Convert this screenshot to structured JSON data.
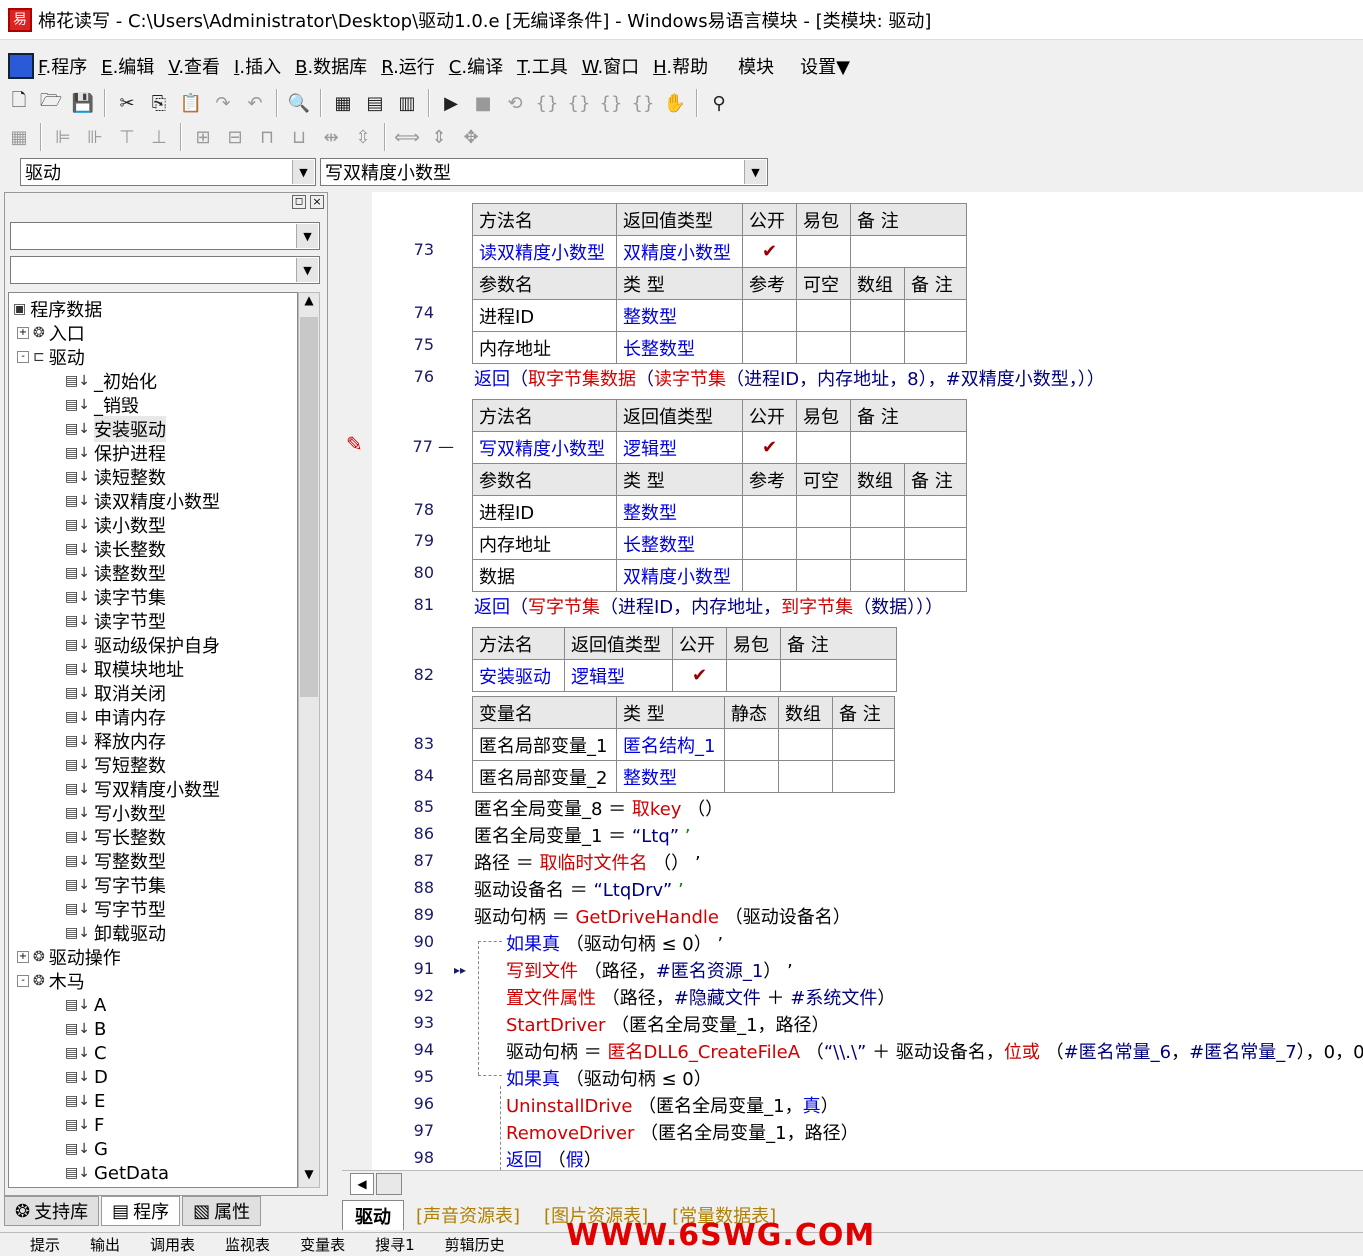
{
  "window": {
    "title": "棉花读写 - C:\\Users\\Administrator\\Desktop\\驱动1.0.e [无编译条件] - Windows易语言模块 - [类模块: 驱动]"
  },
  "menu": {
    "items": [
      {
        "key": "F",
        "label": ".程序"
      },
      {
        "key": "E",
        "label": ".编辑"
      },
      {
        "key": "V",
        "label": ".查看"
      },
      {
        "key": "I",
        "label": ".插入"
      },
      {
        "key": "B",
        "label": ".数据库"
      },
      {
        "key": "R",
        "label": ".运行"
      },
      {
        "key": "C",
        "label": ".编译"
      },
      {
        "key": "T",
        "label": ".工具"
      },
      {
        "key": "W",
        "label": ".窗口"
      },
      {
        "key": "H",
        "label": ".帮助"
      },
      {
        "key": "",
        "label": "模块"
      },
      {
        "key": "",
        "label": "设置▼"
      }
    ]
  },
  "combos": {
    "module": "驱动",
    "method": "写双精度小数型"
  },
  "tree": {
    "root": "程序数据",
    "items": [
      {
        "label": "入口",
        "level": 1,
        "type": "folder",
        "pm": "+"
      },
      {
        "label": "驱动",
        "level": 1,
        "type": "class",
        "pm": "-"
      },
      {
        "label": "_初始化",
        "level": 2,
        "type": "sub"
      },
      {
        "label": "_销毁",
        "level": 2,
        "type": "sub"
      },
      {
        "label": "安装驱动",
        "level": 2,
        "type": "sub"
      },
      {
        "label": "保护进程",
        "level": 2,
        "type": "sub"
      },
      {
        "label": "读短整数",
        "level": 2,
        "type": "sub"
      },
      {
        "label": "读双精度小数型",
        "level": 2,
        "type": "sub"
      },
      {
        "label": "读小数型",
        "level": 2,
        "type": "sub"
      },
      {
        "label": "读长整数",
        "level": 2,
        "type": "sub"
      },
      {
        "label": "读整数型",
        "level": 2,
        "type": "sub"
      },
      {
        "label": "读字节集",
        "level": 2,
        "type": "sub"
      },
      {
        "label": "读字节型",
        "level": 2,
        "type": "sub"
      },
      {
        "label": "驱动级保护自身",
        "level": 2,
        "type": "sub"
      },
      {
        "label": "取模块地址",
        "level": 2,
        "type": "sub"
      },
      {
        "label": "取消关闭",
        "level": 2,
        "type": "sub"
      },
      {
        "label": "申请内存",
        "level": 2,
        "type": "sub"
      },
      {
        "label": "释放内存",
        "level": 2,
        "type": "sub"
      },
      {
        "label": "写短整数",
        "level": 2,
        "type": "sub"
      },
      {
        "label": "写双精度小数型",
        "level": 2,
        "type": "sub"
      },
      {
        "label": "写小数型",
        "level": 2,
        "type": "sub"
      },
      {
        "label": "写长整数",
        "level": 2,
        "type": "sub"
      },
      {
        "label": "写整数型",
        "level": 2,
        "type": "sub"
      },
      {
        "label": "写字节集",
        "level": 2,
        "type": "sub"
      },
      {
        "label": "写字节型",
        "level": 2,
        "type": "sub"
      },
      {
        "label": "卸载驱动",
        "level": 2,
        "type": "sub"
      },
      {
        "label": "驱动操作",
        "level": 1,
        "type": "folder",
        "pm": "+"
      },
      {
        "label": "木马",
        "level": 1,
        "type": "folder",
        "pm": "-"
      },
      {
        "label": "A",
        "level": 2,
        "type": "sub"
      },
      {
        "label": "B",
        "level": 2,
        "type": "sub"
      },
      {
        "label": "C",
        "level": 2,
        "type": "sub"
      },
      {
        "label": "D",
        "level": 2,
        "type": "sub"
      },
      {
        "label": "E",
        "level": 2,
        "type": "sub"
      },
      {
        "label": "F",
        "level": 2,
        "type": "sub"
      },
      {
        "label": "G",
        "level": 2,
        "type": "sub"
      },
      {
        "label": "GetData",
        "level": 2,
        "type": "sub"
      }
    ]
  },
  "bottomtabs": [
    "支持库",
    "程序",
    "属性"
  ],
  "sheettabs": [
    "驱动",
    "[声音资源表]",
    "[图片资源表]",
    "[常量数据表]"
  ],
  "status": [
    "提示",
    "输出",
    "调用表",
    "监视表",
    "变量表",
    "搜寻1",
    "剪辑历史"
  ],
  "watermark": "WWW.6SWG.COM",
  "editor": {
    "hdr_method": [
      "方法名",
      "返回值类型",
      "公开",
      "易包",
      "备 注"
    ],
    "hdr_param": [
      "参数名",
      "类 型",
      "参考",
      "可空",
      "数组",
      "备 注"
    ],
    "hdr_var": [
      "变量名",
      "类 型",
      "静态",
      "数组",
      "备 注"
    ],
    "m1": {
      "name": "读双精度小数型",
      "ret": "双精度小数型",
      "check": "✔"
    },
    "m1p": [
      {
        "n": "进程ID",
        "t": "整数型"
      },
      {
        "n": "内存地址",
        "t": "长整数型"
      }
    ],
    "m2": {
      "name": "写双精度小数型",
      "ret": "逻辑型",
      "check": "✔"
    },
    "m2p": [
      {
        "n": "进程ID",
        "t": "整数型"
      },
      {
        "n": "内存地址",
        "t": "长整数型"
      },
      {
        "n": "数据",
        "t": "双精度小数型"
      }
    ],
    "m3": {
      "name": "安装驱动",
      "ret": "逻辑型",
      "check": "✔"
    },
    "m3v": [
      {
        "n": "匿名局部变量_1",
        "t": "匿名结构_1"
      },
      {
        "n": "匿名局部变量_2",
        "t": "整数型"
      }
    ],
    "lines": {
      "l73": "73",
      "l74": "74",
      "l75": "75",
      "l76": "76",
      "l77": "77 —",
      "l78": "78",
      "l79": "79",
      "l80": "80",
      "l81": "81",
      "l82": "82",
      "l83": "83",
      "l84": "84",
      "l85": "85",
      "l86": "86",
      "l87": "87",
      "l88": "88",
      "l89": "89",
      "l90": "90",
      "l91": "91",
      "l92": "92",
      "l93": "93",
      "l94": "94",
      "l95": "95",
      "l96": "96",
      "l97": "97",
      "l98": "98"
    },
    "c76": {
      "a": "返回",
      "b": "（",
      "c": "取字节集数据",
      "d": "（",
      "e": "读字节集",
      "f": "（进程ID，内存地址，8），",
      "g": "#双精度小数型",
      "h": "，））"
    },
    "c81": {
      "a": "返回",
      "b": "（",
      "c": "写字节集",
      "d": "（进程ID，内存地址，",
      "e": "到字节集",
      "f": "（数据）））"
    },
    "c85": {
      "a": "匿名全局变量_8 ＝ ",
      "b": "取key",
      "c": " （）"
    },
    "c86": {
      "a": "匿名全局变量_1 ＝ ",
      "b": "“Ltq”",
      "c": " ’"
    },
    "c87": {
      "a": "路径 ＝ ",
      "b": "取临时文件名",
      "c": " （） ’"
    },
    "c88": {
      "a": "驱动设备名 ＝ ",
      "b": "“LtqDrv”",
      "c": " ’"
    },
    "c89": {
      "a": "驱动句柄 ＝ ",
      "b": "GetDriveHandle",
      "c": " （驱动设备名）"
    },
    "c90": {
      "a": "如果真",
      "b": " （驱动句柄 ≤ 0） ’"
    },
    "c91": {
      "a": "写到文件",
      "b": " （路径，",
      "c": "#匿名资源_1",
      "d": "） ’"
    },
    "c92": {
      "a": "置文件属性",
      "b": " （路径，",
      "c": "#隐藏文件",
      "d": " ＋ ",
      "e": "#系统文件",
      "f": "）"
    },
    "c93": {
      "a": "StartDriver",
      "b": " （匿名全局变量_1，路径）"
    },
    "c94": {
      "a": "驱动句柄 ＝ ",
      "b": "匿名DLL6_CreateFileA",
      "c": " （",
      "d": "“\\\\.\\”",
      "e": " ＋ 驱动设备名，",
      "f": "位或",
      "g": " （",
      "h": "#匿名常量_6",
      "i": "，",
      "j": "#匿名常量_7",
      "k": "），0，0"
    },
    "c95": {
      "a": "如果真",
      "b": " （驱动句柄 ≤ 0）"
    },
    "c96": {
      "a": "UninstallDrive",
      "b": " （匿名全局变量_1，",
      "c": "真",
      "d": "）"
    },
    "c97": {
      "a": "RemoveDriver",
      "b": " （匿名全局变量_1，路径）"
    },
    "c98": {
      "a": "返回",
      "b": " （",
      "c": "假",
      "d": "）"
    }
  }
}
